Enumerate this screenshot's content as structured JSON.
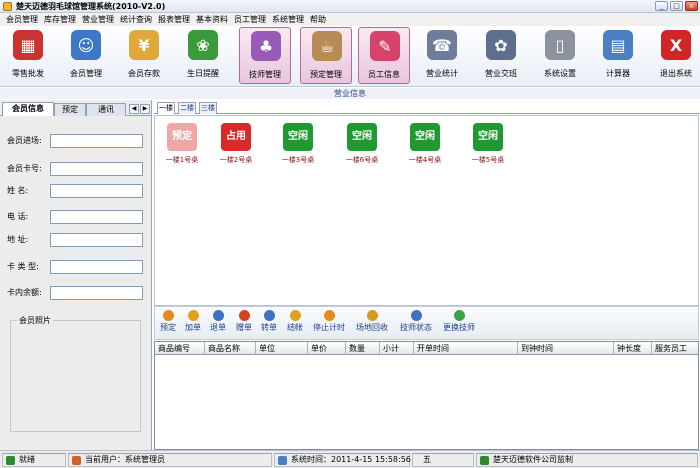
{
  "window": {
    "title": "楚天迈德羽毛球馆管理系统(2010-V2.0)",
    "buttons": {
      "minimize": "_",
      "maximize": "□",
      "close": "×"
    }
  },
  "menu": [
    "会员管理",
    "库存管理",
    "营业管理",
    "统计查询",
    "报表管理",
    "基本资料",
    "员工管理",
    "系统管理",
    "帮助"
  ],
  "toolbar": [
    {
      "label": "零售批发",
      "icon": "cubes-icon",
      "color": "#c9342f",
      "glyph": "▦"
    },
    {
      "label": "会员管理",
      "icon": "members-icon",
      "color": "#3d78c8",
      "glyph": "☺"
    },
    {
      "label": "会员存款",
      "icon": "deposit-icon",
      "color": "#e0a83a",
      "glyph": "¥"
    },
    {
      "label": "生日提醒",
      "icon": "birthday-icon",
      "color": "#3a9a3a",
      "glyph": "❀"
    },
    {
      "label": "技师管理",
      "icon": "technician-icon",
      "color": "#9a5ab8",
      "glyph": "♣"
    },
    {
      "label": "预定管理",
      "icon": "reservation-icon",
      "color": "#b88a55",
      "glyph": "☕"
    },
    {
      "label": "员工信息",
      "icon": "employee-icon",
      "color": "#d5426a",
      "glyph": "✎"
    },
    {
      "label": "营业统计",
      "icon": "fax-icon",
      "color": "#6b7d99",
      "glyph": "☎"
    },
    {
      "label": "营业交班",
      "icon": "shift-icon",
      "color": "#5d6f8c",
      "glyph": "✿"
    },
    {
      "label": "系统设置",
      "icon": "settings-icon",
      "color": "#8c939e",
      "glyph": "▯"
    },
    {
      "label": "计算器",
      "icon": "calculator-icon",
      "color": "#4a7fc1",
      "glyph": "▤"
    },
    {
      "label": "退出系统",
      "icon": "exit-icon",
      "color": "#d02626",
      "glyph": "X"
    }
  ],
  "section_label": "营业信息",
  "left_panel": {
    "tabs": [
      "会员信息",
      "预定",
      "通讯"
    ],
    "arrows": [
      "◀",
      "▶"
    ],
    "fields": [
      {
        "label": "会员进场:",
        "value": ""
      },
      {
        "label": "会员卡号:",
        "value": ""
      },
      {
        "label": "姓    名:",
        "value": ""
      },
      {
        "label": "电    话:",
        "value": ""
      },
      {
        "label": "地    址:",
        "value": ""
      },
      {
        "label": "卡 类 型:",
        "value": ""
      },
      {
        "label": "卡内余额:",
        "value": ""
      }
    ],
    "photo_caption": "会员照片"
  },
  "floor_tabs": [
    "一楼",
    "二楼",
    "三楼"
  ],
  "courts": [
    {
      "status": "预定",
      "name": "一楼1号桌",
      "color": "#f0a6a6"
    },
    {
      "status": "占用",
      "name": "一楼2号桌",
      "color": "#d92a2a"
    },
    {
      "status": "空闲",
      "name": "一楼3号桌",
      "color": "#1f9a33"
    },
    {
      "status": "空闲",
      "name": "一楼6号桌",
      "color": "#1f9a33"
    },
    {
      "status": "空闲",
      "name": "一楼4号桌",
      "color": "#1f9a33"
    },
    {
      "status": "空闲",
      "name": "一楼5号桌",
      "color": "#1f9a33"
    }
  ],
  "actions": [
    {
      "label": "预定",
      "icon": "reserve-icon",
      "color": "#e58b1b"
    },
    {
      "label": "加单",
      "icon": "add-order-icon",
      "color": "#e1a21b"
    },
    {
      "label": "退单",
      "icon": "return-order-icon",
      "color": "#3d71c4"
    },
    {
      "label": "赠单",
      "icon": "gift-order-icon",
      "color": "#d3431e"
    },
    {
      "label": "转单",
      "icon": "transfer-order-icon",
      "color": "#3d71c4"
    },
    {
      "label": "结帐",
      "icon": "checkout-icon",
      "color": "#e1a21b"
    },
    {
      "label": "停止计时",
      "icon": "stop-timer-icon",
      "color": "#e58b1b"
    },
    {
      "label": "场地回收",
      "icon": "court-reclaim-icon",
      "color": "#d79b1b"
    },
    {
      "label": "技师状态",
      "icon": "technician-status-icon",
      "color": "#3d71c4"
    },
    {
      "label": "更换技师",
      "icon": "change-technician-icon",
      "color": "#3aa34a"
    }
  ],
  "grid_columns": [
    "商品编号",
    "商品名称",
    "单位",
    "单价",
    "数量",
    "小计",
    "开单时间",
    "到钟时间",
    "钟长度",
    "服务员工"
  ],
  "status": {
    "ready": "就绪",
    "user": "当前用户：系统管理员",
    "time": "系统时间：2011-4-15  15:58:56",
    "weekday": "五",
    "company": "楚天迈德软件公司监制"
  }
}
